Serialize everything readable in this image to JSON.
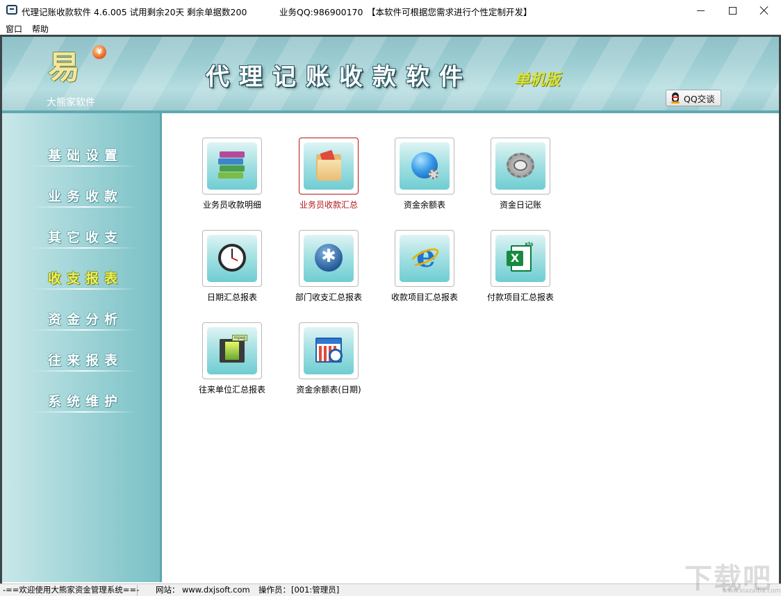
{
  "titlebar": {
    "title": "代理记账收款软件 4.6.005  试用剩余20天  剩余单据数200",
    "qq": "业务QQ:986900170",
    "custom": "【本软件可根据您需求进行个性定制开发】"
  },
  "menu": {
    "window": "窗口",
    "help": "帮助"
  },
  "banner": {
    "logo_mark": "易",
    "logo_coin": "¥",
    "company": "大熊家软件",
    "product_title": "代理记账收款软件",
    "edition": "单机版",
    "qq_button": "QQ交谈"
  },
  "sidebar": {
    "items": [
      {
        "label": "基础设置"
      },
      {
        "label": "业务收款"
      },
      {
        "label": "其它收支"
      },
      {
        "label": "收支报表",
        "active": true
      },
      {
        "label": "资金分析"
      },
      {
        "label": "往来报表"
      },
      {
        "label": "系统维护"
      }
    ]
  },
  "reports": {
    "items": [
      {
        "label": "业务员收款明细",
        "icon": "books-icon"
      },
      {
        "label": "业务员收款汇总",
        "icon": "folder-icon",
        "selected": true
      },
      {
        "label": "资金余额表",
        "icon": "globe-icon"
      },
      {
        "label": "资金日记账",
        "icon": "gear-icon"
      },
      {
        "label": "日期汇总报表",
        "icon": "clock-icon"
      },
      {
        "label": "部门收支汇总报表",
        "icon": "accessibility-icon"
      },
      {
        "label": "收款项目汇总报表",
        "icon": "ie-icon"
      },
      {
        "label": "付款项目汇总报表",
        "icon": "excel-icon"
      },
      {
        "label": "往来单位汇总报表",
        "icon": "film-icon"
      },
      {
        "label": "资金余额表(日期)",
        "icon": "calendar-clock-icon"
      }
    ]
  },
  "icon_tags": {
    "excel": "xls",
    "film": "mpeg"
  },
  "statusbar": {
    "welcome": "-==欢迎使用大熊家资金管理系统==-",
    "site_label": "网站：",
    "site": "www.dxjsoft.com",
    "operator_label": "操作员：",
    "operator": "[001:管理员]"
  },
  "watermark": {
    "main": "下载吧",
    "sub": "www.xiazaiba.com"
  },
  "colors": {
    "sidebar": "#88c8cc",
    "banner": "#9ccdd2",
    "active_menu": "#f0f05a",
    "selected_report": "#b01818",
    "edition": "#d7e23c"
  }
}
